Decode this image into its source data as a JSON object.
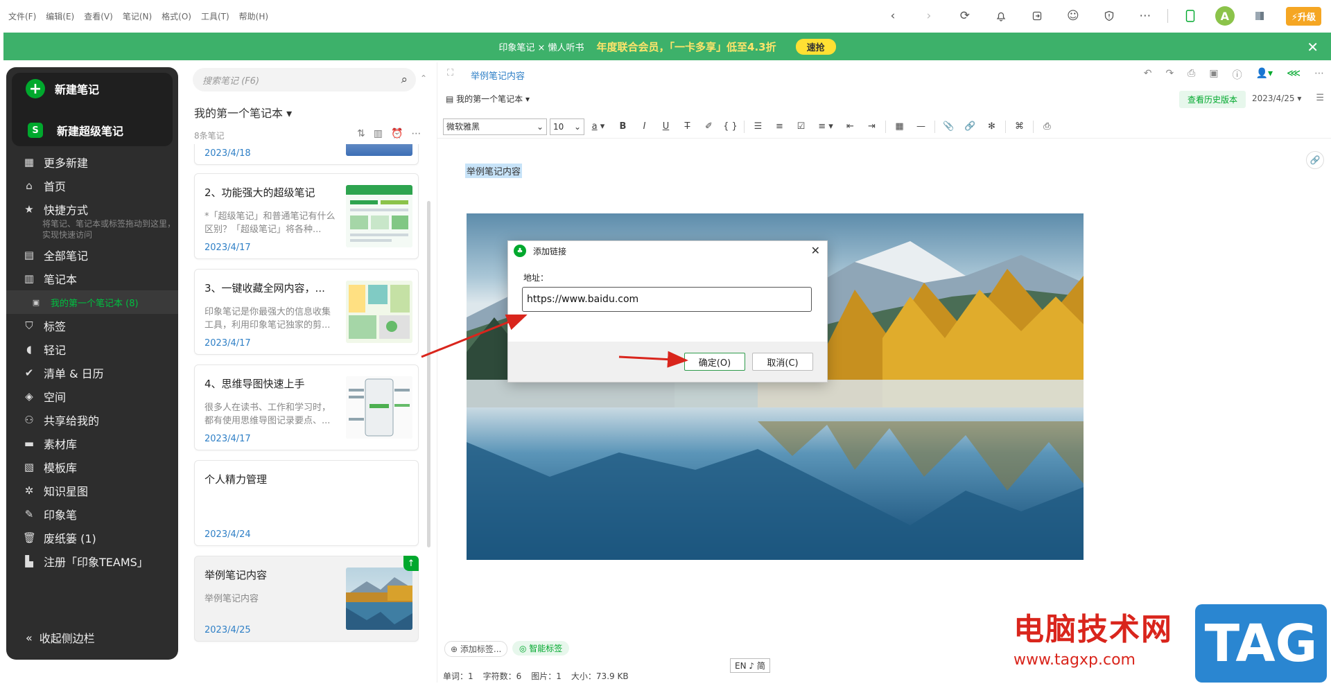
{
  "menu": [
    "文件(F)",
    "编辑(E)",
    "查看(V)",
    "笔记(N)",
    "格式(O)",
    "工具(T)",
    "帮助(H)"
  ],
  "topbar": {
    "avatar_letter": "A",
    "upgrade_label": "升级"
  },
  "banner": {
    "brand": "印象笔记 × 懒人听书",
    "text": "年度联合会员，「一卡多享」低至4.3折",
    "button": "速抢"
  },
  "sidebar": {
    "new_note": "新建笔记",
    "new_super_note": "新建超级笔记",
    "super_badge": "S",
    "items": [
      {
        "label": "更多新建",
        "icon": "grid-icon"
      },
      {
        "label": "首页",
        "icon": "home-icon"
      },
      {
        "label": "快捷方式",
        "icon": "star-icon"
      },
      {
        "label": "全部笔记",
        "icon": "note-icon"
      },
      {
        "label": "笔记本",
        "icon": "notebook-icon"
      },
      {
        "label": "标签",
        "icon": "tag-icon"
      },
      {
        "label": "轻记",
        "icon": "quick-note-icon"
      },
      {
        "label": "清单 & 日历",
        "icon": "check-icon"
      },
      {
        "label": "空间",
        "icon": "space-icon"
      },
      {
        "label": "共享给我的",
        "icon": "shared-icon"
      },
      {
        "label": "素材库",
        "icon": "library-icon"
      },
      {
        "label": "模板库",
        "icon": "template-icon"
      },
      {
        "label": "知识星图",
        "icon": "graph-icon"
      },
      {
        "label": "印象笔",
        "icon": "pen-icon"
      },
      {
        "label": "废纸篓 (1)",
        "icon": "trash-icon"
      },
      {
        "label": "注册「印象TEAMS」",
        "icon": "building-icon"
      }
    ],
    "shortcut_hint": "将笔记、笔记本或标签拖动到这里，实现快速访问",
    "active_notebook": "我的第一个笔记本 (8)",
    "collapse": "收起侧边栏"
  },
  "notelist": {
    "search_placeholder": "搜索笔记 (F6)",
    "notebook_title": "我的第一个笔记本 ▾",
    "count": "8条笔记",
    "cards": [
      {
        "title": "",
        "snippet": "",
        "date": "2023/4/18"
      },
      {
        "title": "2、功能强大的超级笔记",
        "snippet": "*「超级笔记」和普通笔记有什么区别？「超级笔记」将各种...",
        "date": "2023/4/17"
      },
      {
        "title": "3、一键收藏全网内容，...",
        "snippet": "印象笔记是你最强大的信息收集工具，利用印象笔记独家的剪...",
        "date": "2023/4/17"
      },
      {
        "title": "4、思维导图快速上手",
        "snippet": "很多人在读书、工作和学习时，都有使用思维导图记录要点、...",
        "date": "2023/4/17"
      },
      {
        "title": "个人精力管理",
        "snippet": "",
        "date": "2023/4/24"
      },
      {
        "title": "举例笔记内容",
        "snippet": "举例笔记内容",
        "date": "2023/4/25"
      }
    ]
  },
  "editor": {
    "title": "举例笔记内容",
    "notebook": "我的第一个笔记本 ▾",
    "history_btn": "查看历史版本",
    "date": "2023/4/25 ▾",
    "font": "微软雅黑",
    "size": "10",
    "content_text": "举例笔记内容",
    "add_tag": "添加标签...",
    "smart_tag": "智能标签",
    "ime": "EN ♪ 简",
    "status": [
      "单词：1",
      "字符数：6",
      "图片：1",
      "大小：73.9 KB"
    ]
  },
  "dialog": {
    "title": "添加链接",
    "label": "地址：",
    "url": "https://www.baidu.com",
    "ok": "确定(O)",
    "cancel": "取消(C)"
  },
  "watermark": {
    "title": "电脑技术网",
    "url": "www.tagxp.com",
    "tag": "TAG"
  },
  "colors": {
    "brand_green": "#00a82d",
    "banner_green": "#3db16a",
    "annotation_red": "#d9251c"
  }
}
